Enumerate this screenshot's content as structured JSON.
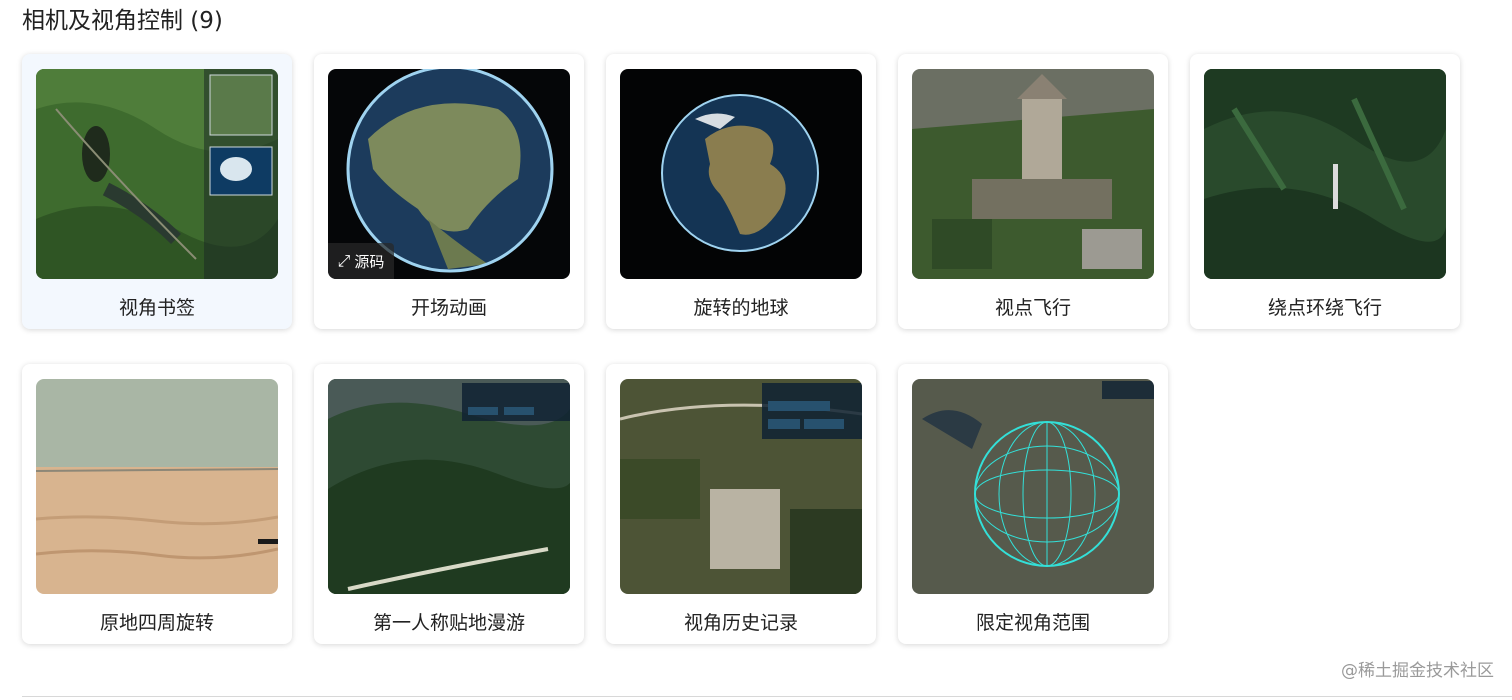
{
  "section": {
    "title": "相机及视角控制 (9)"
  },
  "cards": [
    {
      "label": "视角书签"
    },
    {
      "label": "开场动画",
      "badge": "源码",
      "badge_icon": "expand-icon"
    },
    {
      "label": "旋转的地球"
    },
    {
      "label": "视点飞行"
    },
    {
      "label": "绕点环绕飞行"
    },
    {
      "label": "原地四周旋转"
    },
    {
      "label": "第一人称贴地漫游"
    },
    {
      "label": "视角历史记录"
    },
    {
      "label": "限定视角范围"
    }
  ],
  "watermark": "@稀土掘金技术社区",
  "colors": {
    "accent_card_bg": "#f3f8fe",
    "globe_outline": "#9fd3f0",
    "wireframe": "#33e0d8"
  }
}
